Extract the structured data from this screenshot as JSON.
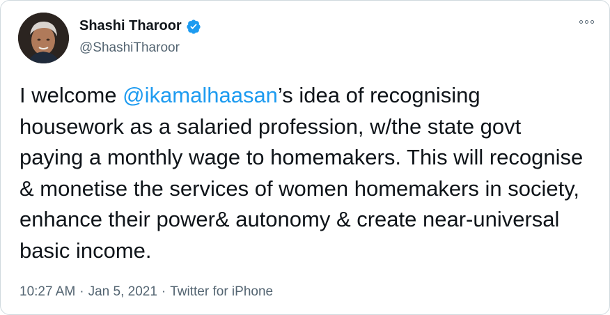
{
  "author": {
    "display_name": "Shashi Tharoor",
    "handle": "@ShashiTharoor",
    "verified_icon": "verified-badge-icon",
    "accent_color": "#1d9bf0"
  },
  "tweet": {
    "text_before_mention": "I welcome ",
    "mention": "@ikamalhaasan",
    "text_after_mention": "’s idea of  recognising housework as a salaried profession, w/the state govt paying a monthly wage to homemakers. This will recognise & monetise the services of women homemakers in society, enhance their power& autonomy & create near-universal basic income."
  },
  "meta": {
    "time": "10:27 AM",
    "separator": "·",
    "date": "Jan 5, 2021",
    "source": "Twitter for iPhone"
  },
  "menu": {
    "icon": "more-options-icon"
  }
}
